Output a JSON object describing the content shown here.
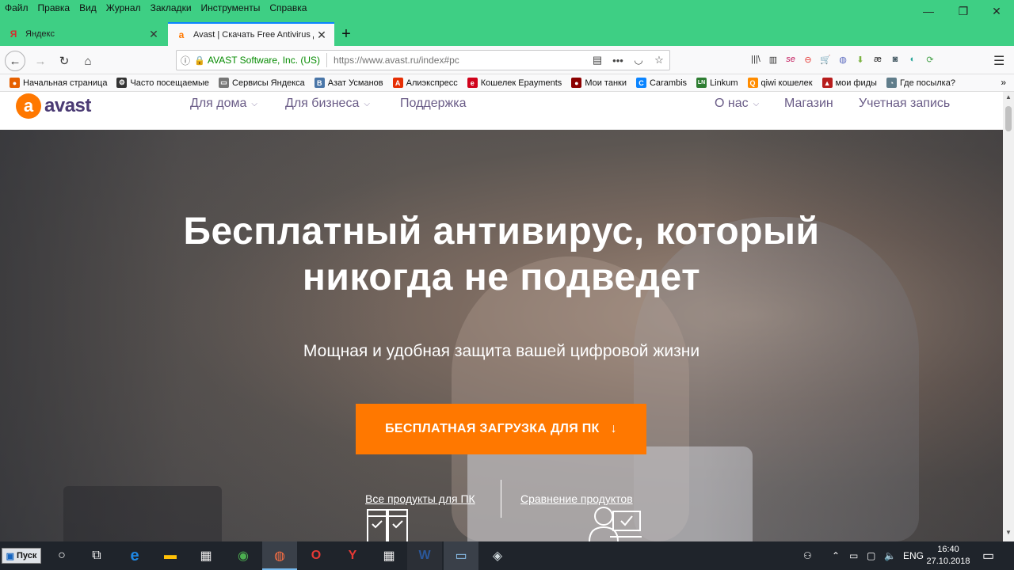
{
  "menubar": {
    "items": [
      "Файл",
      "Правка",
      "Вид",
      "Журнал",
      "Закладки",
      "Инструменты",
      "Справка"
    ],
    "controls": [
      "—",
      "❐",
      "✕"
    ]
  },
  "tabs": [
    {
      "title": "Яндекс",
      "favicon": "Я",
      "close": "✕"
    },
    {
      "title": "Avast | Скачать Free Antivirus д",
      "favicon": "a",
      "close": "✕"
    }
  ],
  "newtab": "+",
  "nav": {
    "back": "←",
    "forward": "→",
    "reload": "↻",
    "home": "⌂",
    "url_org": "AVAST Software, Inc. (US)",
    "url": "https://www.avast.ru/index#pc",
    "reader": "▤",
    "more": "•••",
    "pocket": "◡",
    "star": "☆",
    "menu": "☰"
  },
  "toolbar_icons": [
    "|||\\",
    "▥",
    "se",
    "⊖",
    "🛒",
    "◍",
    "⬇",
    "æ",
    "◙",
    "◐",
    "⟳"
  ],
  "bookmarks": [
    {
      "label": "Начальная страница",
      "color": "#e66000",
      "glyph": "●"
    },
    {
      "label": "Часто посещаемые",
      "color": "#333333",
      "glyph": "⚙"
    },
    {
      "label": "Сервисы Яндекса",
      "color": "#666666",
      "glyph": "▭"
    },
    {
      "label": "Азат Усманов",
      "color": "#4a76a8",
      "glyph": "В"
    },
    {
      "label": "Алиэкспресс",
      "color": "#e62e04",
      "glyph": "A"
    },
    {
      "label": "Кошелек Epayments",
      "color": "#d0021b",
      "glyph": "e"
    },
    {
      "label": "Мои танки",
      "color": "#8b0000",
      "glyph": "●"
    },
    {
      "label": "Carambis",
      "color": "#0a84ff",
      "glyph": "C"
    },
    {
      "label": "Linkum",
      "color": "#2e7d32",
      "glyph": "LN"
    },
    {
      "label": "qiwi кошелек",
      "color": "#ff8c00",
      "glyph": "Q"
    },
    {
      "label": "мои фиды",
      "color": "#b71c1c",
      "glyph": "▲"
    },
    {
      "label": "Где посылка?",
      "color": "#607d8b",
      "glyph": "◔"
    }
  ],
  "bookmarks_more": "»",
  "site": {
    "logo_mark": "a",
    "logo_word": "avast",
    "nav_left": [
      {
        "label": "Для дома",
        "chev": "⌵"
      },
      {
        "label": "Для бизнеса",
        "chev": "⌵"
      },
      {
        "label": "Поддержка",
        "chev": ""
      }
    ],
    "nav_right": [
      {
        "label": "О нас",
        "chev": "⌵"
      },
      {
        "label": "Магазин",
        "chev": ""
      },
      {
        "label": "Учетная запись",
        "chev": ""
      }
    ],
    "headline_1": "Бесплатный антивирус, который",
    "headline_2": "никогда не подведет",
    "subtitle": "Мощная и удобная защита вашей цифровой жизни",
    "cta": "БЕСПЛАТНАЯ ЗАГРУЗКА ДЛЯ ПК",
    "cta_arrow": "↓",
    "link_all": "Все продукты для ПК",
    "link_compare": "Сравнение продуктов"
  },
  "scrollbar": {
    "up": "▲",
    "down": "▼"
  },
  "taskbar": {
    "start": "Пуск",
    "apps": [
      {
        "name": "search",
        "glyph": "○"
      },
      {
        "name": "task-view",
        "glyph": "⧉"
      },
      {
        "name": "edge",
        "glyph": "e"
      },
      {
        "name": "explorer",
        "glyph": "▬"
      },
      {
        "name": "store",
        "glyph": "▦"
      },
      {
        "name": "chrome",
        "glyph": "◉"
      },
      {
        "name": "firefox",
        "glyph": "◍"
      },
      {
        "name": "opera",
        "glyph": "O"
      },
      {
        "name": "yandex",
        "glyph": "Y"
      },
      {
        "name": "calculator",
        "glyph": "▦"
      },
      {
        "name": "word",
        "glyph": "W"
      },
      {
        "name": "display",
        "glyph": "▭"
      },
      {
        "name": "app",
        "glyph": "◈"
      }
    ],
    "tray_lang": "ENG",
    "time": "16:40",
    "date": "27.10.2018"
  }
}
